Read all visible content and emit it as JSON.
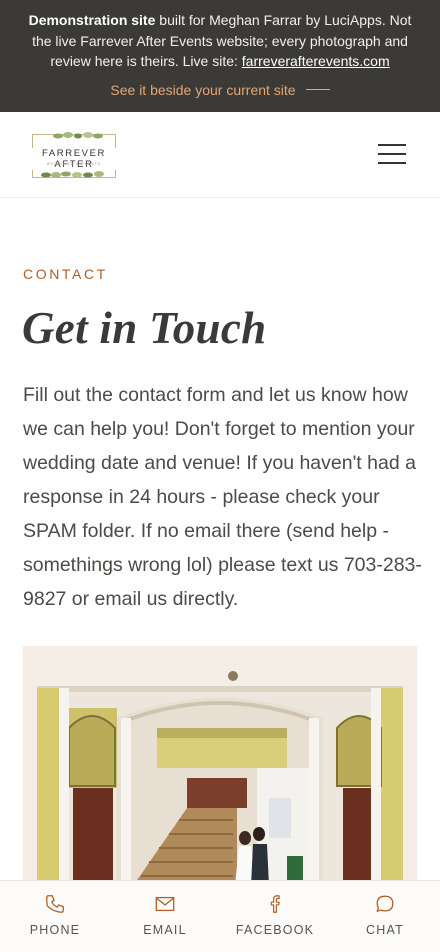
{
  "banner": {
    "strong": "Demonstration site",
    "text": " built for Meghan Farrar by LuciApps. Not the live Farrever After Events website; every photograph and review here is theirs. Live site: ",
    "link": "farreverafterevents.com",
    "cta": "See it beside your current site",
    "accent_color": "#e2a574",
    "bg_color": "#3b3a37"
  },
  "header": {
    "logo_text": "FARREVER AFTER",
    "logo_sub": "WEDDINGS & EVENTS",
    "menu_icon": "hamburger-icon"
  },
  "main": {
    "eyebrow": "CONTACT",
    "eyebrow_color": "#b05e22",
    "title": "Get in Touch",
    "body": "Fill out the contact form and let us know how we can help you! Don't forget to mention your wedding date and venue! If you haven't had a response in 24 hours - please check your SPAM folder. If no email there (send help - somethings wrong lol) please text us 703-283-9827 or email us directly."
  },
  "bottom_nav": {
    "items": [
      {
        "label": "PHONE",
        "icon": "phone-icon"
      },
      {
        "label": "EMAIL",
        "icon": "mail-icon"
      },
      {
        "label": "FACEBOOK",
        "icon": "facebook-icon"
      },
      {
        "label": "CHAT",
        "icon": "chat-icon"
      }
    ],
    "icon_color": "#b05e22"
  }
}
